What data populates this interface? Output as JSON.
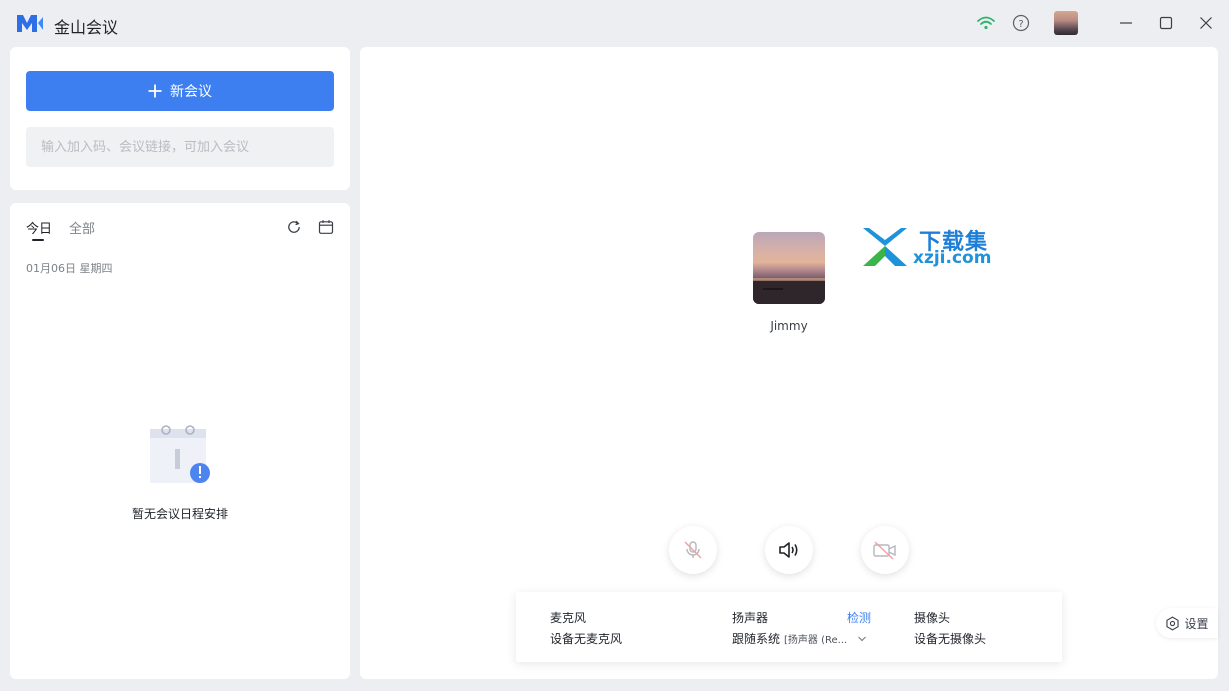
{
  "app": {
    "title": "金山会议"
  },
  "left": {
    "new_meeting_label": "新会议",
    "join_placeholder": "输入加入码、会议链接，可加入会议"
  },
  "schedule": {
    "tabs": [
      {
        "label": "今日",
        "active": true
      },
      {
        "label": "全部",
        "active": false
      }
    ],
    "date": "01月06日 星期四",
    "empty_text": "暂无会议日程安排"
  },
  "main": {
    "user_name": "Jimmy",
    "watermark": {
      "line1": "下载集",
      "line2": "xzji.com"
    }
  },
  "devices": {
    "mic_label": "麦克风",
    "mic_value": "设备无麦克风",
    "speaker_label": "扬声器",
    "speaker_check": "检测",
    "speaker_value": "跟随系统",
    "speaker_sub": "[扬声器 (Re...",
    "camera_label": "摄像头",
    "camera_value": "设备无摄像头"
  },
  "settings_label": "设置",
  "colors": {
    "accent": "#3d7ff0",
    "wifi": "#2fb36b",
    "background": "#eceef2"
  },
  "icons": [
    "logo-icon",
    "wifi-icon",
    "help-icon",
    "minimize-icon",
    "maximize-icon",
    "close-icon",
    "plus-icon",
    "refresh-icon",
    "calendar-icon",
    "mic-off-icon",
    "speaker-icon",
    "camera-off-icon",
    "chevron-down-icon",
    "gear-icon"
  ]
}
